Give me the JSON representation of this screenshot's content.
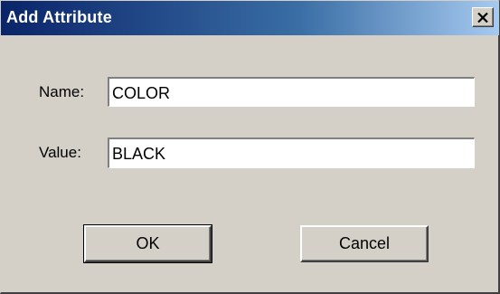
{
  "window": {
    "title": "Add Attribute",
    "close_label": "close"
  },
  "form": {
    "name_label": "Name:",
    "name_value": "COLOR",
    "value_label": "Value:",
    "value_value": "BLACK"
  },
  "buttons": {
    "ok_label": "OK",
    "cancel_label": "Cancel"
  },
  "colors": {
    "titlebar_start": "#0a246a",
    "titlebar_end": "#a6caf0",
    "dialog_bg": "#d4d0c8"
  }
}
